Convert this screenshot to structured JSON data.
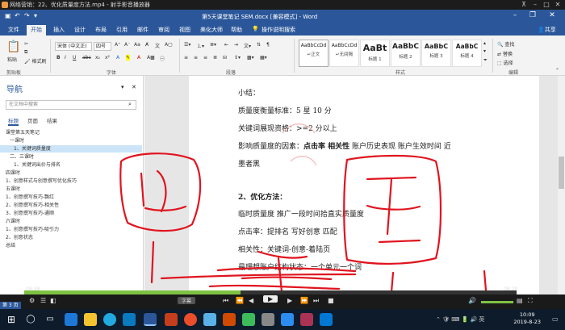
{
  "player": {
    "title": "网络营销：22、优化质量度方法.mp4 - 射手影音播放器"
  },
  "word": {
    "doc_title": "第5天课堂笔记 SEM.docx [兼容模式] - Word",
    "share": "共享"
  },
  "tabs": [
    "文件",
    "开始",
    "插入",
    "设计",
    "布局",
    "引用",
    "邮件",
    "审阅",
    "视图",
    "美化大师",
    "帮助",
    "操作说明搜索"
  ],
  "ribbon": {
    "paste": "粘贴",
    "format_painter": "格式刷",
    "font_name": "宋体 (中文正)",
    "font_size": "四号",
    "styles": [
      {
        "sample": "AaBbCcDd",
        "name": "↵正文"
      },
      {
        "sample": "AaBbCcDd",
        "name": "↵无间隔"
      },
      {
        "sample": "AaBt",
        "name": "标题 1"
      },
      {
        "sample": "AaBbC",
        "name": "标题 2"
      },
      {
        "sample": "AaBbC",
        "name": "标题 3"
      },
      {
        "sample": "AaBbC",
        "name": "标题 4"
      }
    ],
    "find": "查找",
    "replace": "替换",
    "select": "选择",
    "groups": [
      "剪贴板",
      "字体",
      "段落",
      "样式",
      "编辑"
    ]
  },
  "nav": {
    "title": "导航",
    "search_placeholder": "在文档中搜索",
    "tabs": [
      "标题",
      "页面",
      "结果"
    ],
    "items": [
      {
        "text": "课堂第五天笔记",
        "indent": 0
      },
      {
        "text": "一课时",
        "indent": 1
      },
      {
        "text": "1、关键词质量度",
        "indent": 2,
        "selected": true
      },
      {
        "text": "二、三课时",
        "indent": 1
      },
      {
        "text": "1、关键词出价与排名",
        "indent": 2
      },
      {
        "text": "四课时",
        "indent": 0
      },
      {
        "text": "1、创意样式与创意撰写优化技巧",
        "indent": 0
      },
      {
        "text": "五课时",
        "indent": 0
      },
      {
        "text": "1、创意撰写技巧-飘红",
        "indent": 0
      },
      {
        "text": "2、创意撰写技巧-相关性",
        "indent": 0
      },
      {
        "text": "3、创意撰写技巧-通顺",
        "indent": 0
      },
      {
        "text": "六课时",
        "indent": 0
      },
      {
        "text": "1、创意撰写技巧-吸引力",
        "indent": 0
      },
      {
        "text": "2、创意状态",
        "indent": 0
      },
      {
        "text": "总结",
        "indent": 0
      }
    ]
  },
  "doc": {
    "l1": "小结：",
    "l2": "质量度衡量标准：5 星 10 分",
    "l3": "关键词展现资格：>=2 分以上",
    "l4a": "影响质量度的因素：",
    "l4b": "点击率  相关性",
    "l4c": "  账户历史表现  账户生效时间  近",
    "l5": "墨者黑",
    "l6": "2、优化方法：",
    "l7": "临时质量度    推广一段时间拾直实质量度",
    "l8": "点击率：提排名    写好创意    匹配",
    "l9": "相关性：关键词-创意-着陆页",
    "l10": "最理想账户结构状态：一个单元一个词"
  },
  "playback": {
    "elapsed": "08:38",
    "remaining": "- 08:29",
    "subtitle_btn": "字幕",
    "progress_fraction": 0.44
  },
  "status": {
    "page": "第 3 页"
  },
  "clock": {
    "time": "10:09",
    "date": "2019-8-23"
  },
  "colors": {
    "word_blue": "#2b579a",
    "ink_red": "#e0141e",
    "progress_green": "#7dc242"
  }
}
